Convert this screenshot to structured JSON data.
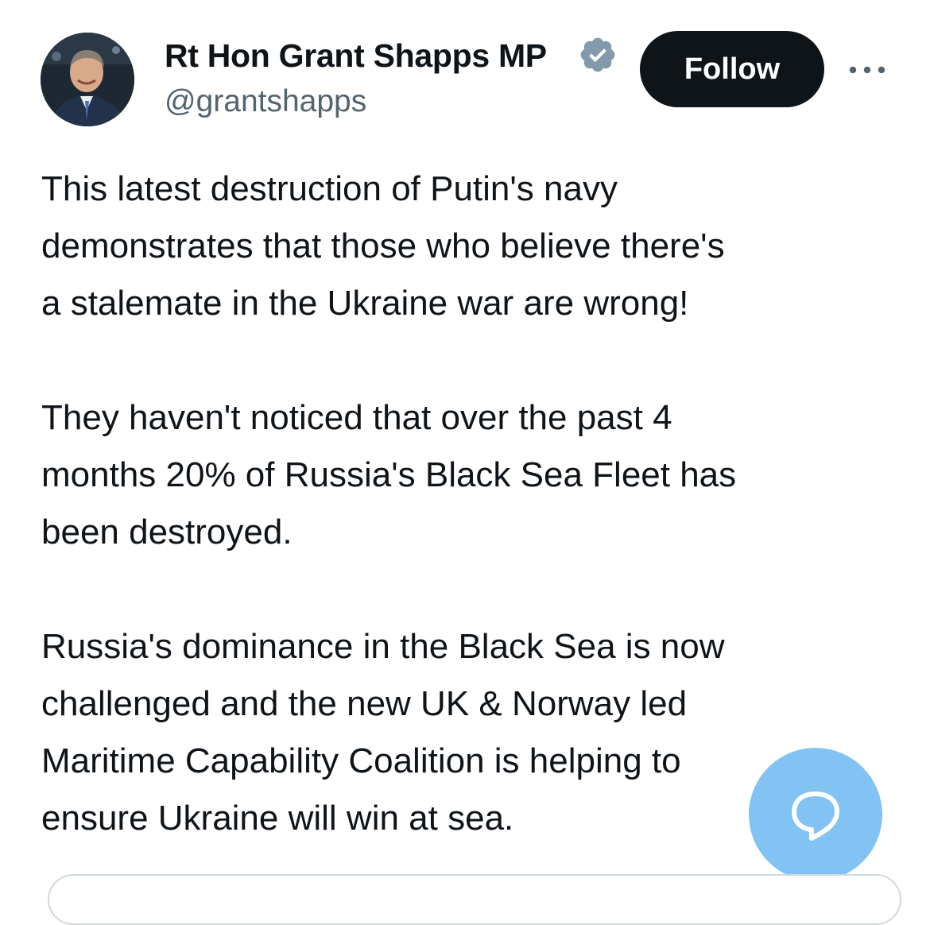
{
  "author": {
    "display_name": "Rt Hon Grant Shapps MP",
    "handle": "@grantshapps",
    "verified": true,
    "avatar_icon": "profile-photo"
  },
  "header": {
    "follow_label": "Follow",
    "more_icon": "ellipsis-icon"
  },
  "tweet": {
    "paragraphs": [
      "This latest destruction of Putin's navy\ndemonstrates that those who believe there's\na stalemate in the Ukraine war are wrong!",
      "They haven't noticed that over the past 4\nmonths 20% of Russia's Black Sea Fleet has\nbeen destroyed.",
      "Russia's dominance in the Black Sea is now\nchallenged and the new UK & Norway led\nMaritime Capability Coalition is helping to\nensure Ukraine will win at sea."
    ]
  },
  "fab": {
    "icon": "reply-bubble-icon",
    "color": "#1d9bf0"
  },
  "colors": {
    "text": "#0f1419",
    "secondary": "#536471",
    "verified_badge": "#829aab",
    "follow_bg": "#0f1419"
  }
}
